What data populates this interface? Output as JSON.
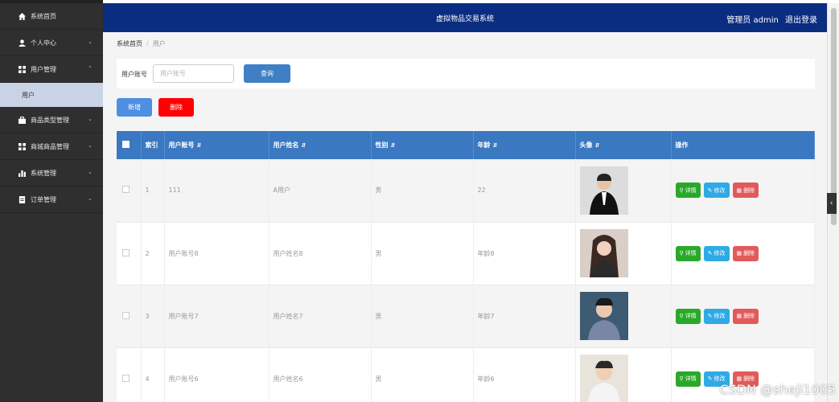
{
  "sidebar": {
    "items": [
      {
        "label": "系统首页",
        "icon": "home-icon"
      },
      {
        "label": "个人中心",
        "icon": "user-icon"
      },
      {
        "label": "用户管理",
        "icon": "grid-icon"
      },
      {
        "label": "商品类型管理",
        "icon": "briefcase-icon"
      },
      {
        "label": "商城商品管理",
        "icon": "grid-icon"
      },
      {
        "label": "系统管理",
        "icon": "bar-chart-icon"
      },
      {
        "label": "订单管理",
        "icon": "document-icon"
      }
    ],
    "sub_item": "用户"
  },
  "header": {
    "title": "虚拟物品交易系统",
    "admin": "管理员 admin",
    "logout": "退出登录"
  },
  "breadcrumb": {
    "home": "系统首页",
    "current": "用户"
  },
  "search": {
    "label": "用户账号",
    "placeholder": "用户账号",
    "button": "查询"
  },
  "actions": {
    "add": "新增",
    "delete": "删除"
  },
  "table": {
    "columns": [
      "索引",
      "用户账号",
      "用户姓名",
      "性别",
      "年龄",
      "头像",
      "操作"
    ],
    "rows": [
      {
        "index": "1",
        "account": "111",
        "name": "A用户",
        "gender": "男",
        "age": "22"
      },
      {
        "index": "2",
        "account": "用户账号8",
        "name": "用户姓名8",
        "gender": "男",
        "age": "年龄8"
      },
      {
        "index": "3",
        "account": "用户账号7",
        "name": "用户姓名7",
        "gender": "男",
        "age": "年龄7"
      },
      {
        "index": "4",
        "account": "用户账号6",
        "name": "用户姓名6",
        "gender": "男",
        "age": "年龄6"
      }
    ],
    "ops": {
      "detail": "详情",
      "edit": "修改",
      "remove": "删除"
    }
  },
  "watermark": "CSDN @sheji1005",
  "colors": {
    "topbar": "#0b2d81",
    "sidebar": "#2f2f2f",
    "table_header": "#3a78c1",
    "detail": "#2aa82a",
    "edit": "#2eaae6",
    "remove": "#e25a5a",
    "delete_main": "#ff0000"
  }
}
